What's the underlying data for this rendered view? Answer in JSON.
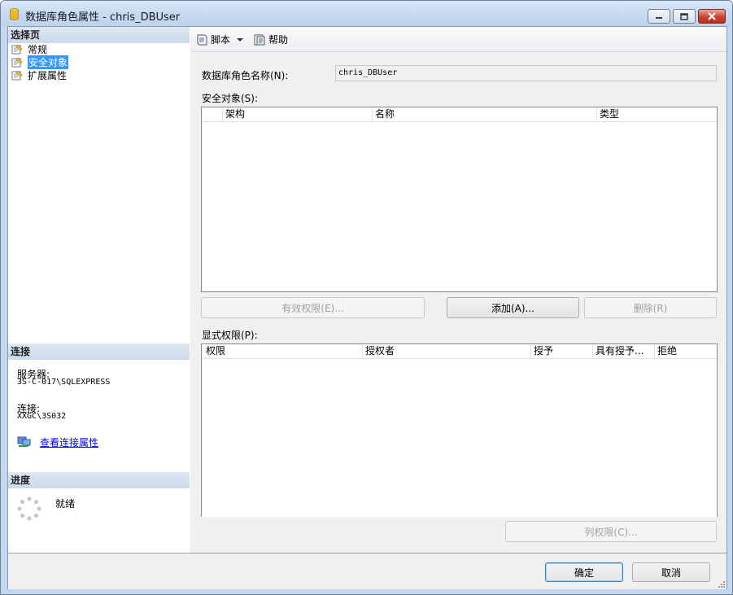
{
  "window": {
    "title": "数据库角色属性 - chris_DBUser"
  },
  "left": {
    "select_page_header": "选择页",
    "pages": [
      {
        "label": "常规",
        "selected": false
      },
      {
        "label": "安全对象",
        "selected": true
      },
      {
        "label": "扩展属性",
        "selected": false
      }
    ],
    "connection_header": "连接",
    "server_label": "服务器:",
    "server_value": "3S-C-017\\SQLEXPRESS",
    "connection_label": "连接:",
    "connection_value": "XXGC\\3S032",
    "view_connection_link": "查看连接属性",
    "progress_header": "进度",
    "progress_status": "就绪"
  },
  "toolbar": {
    "script_label": "脚本",
    "help_label": "帮助"
  },
  "main": {
    "role_name_label": "数据库角色名称(N):",
    "role_name_value": "chris_DBUser",
    "securables_label": "安全对象(S):",
    "securables_columns": [
      "架构",
      "名称",
      "类型"
    ],
    "effective_permissions_button": "有效权限(E)...",
    "add_button": "添加(A)...",
    "remove_button": "删除(R)",
    "explicit_permissions_label": "显式权限(P):",
    "permissions_columns": [
      "权限",
      "授权者",
      "授予",
      "具有授予...",
      "拒绝"
    ],
    "column_permissions_button": "列权限(C)..."
  },
  "footer": {
    "ok_button": "确定",
    "cancel_button": "取消"
  }
}
